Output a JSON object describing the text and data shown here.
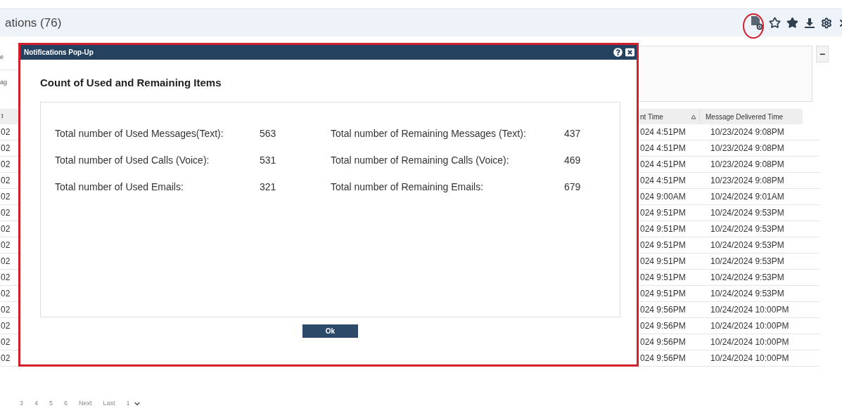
{
  "header": {
    "title": "ations (76)"
  },
  "left_strip": {
    "labels": [
      "e",
      "ag"
    ],
    "header": "t",
    "cells": [
      "02",
      "02",
      "02",
      "02",
      "02",
      "02",
      "02",
      "02",
      "02",
      "02",
      "02",
      "02",
      "02",
      "02",
      "02"
    ]
  },
  "collapse_button": "−",
  "table": {
    "columns": [
      "nt Time",
      "Message Delivered Time"
    ],
    "rows": [
      [
        "024 4:51PM",
        "10/23/2024 9:08PM"
      ],
      [
        "024 4:51PM",
        "10/23/2024 9:08PM"
      ],
      [
        "024 4:51PM",
        "10/23/2024 9:08PM"
      ],
      [
        "024 4:51PM",
        "10/23/2024 9:08PM"
      ],
      [
        "024 9:00AM",
        "10/24/2024 9:01AM"
      ],
      [
        "024 9:51PM",
        "10/24/2024 9:53PM"
      ],
      [
        "024 9:51PM",
        "10/24/2024 9:53PM"
      ],
      [
        "024 9:51PM",
        "10/24/2024 9:53PM"
      ],
      [
        "024 9:51PM",
        "10/24/2024 9:53PM"
      ],
      [
        "024 9:51PM",
        "10/24/2024 9:53PM"
      ],
      [
        "024 9:51PM",
        "10/24/2024 9:53PM"
      ],
      [
        "024 9:56PM",
        "10/24/2024 10:00PM"
      ],
      [
        "024 9:56PM",
        "10/24/2024 10:00PM"
      ],
      [
        "024 9:56PM",
        "10/24/2024 10:00PM"
      ],
      [
        "024 9:56PM",
        "10/24/2024 10:00PM"
      ]
    ]
  },
  "pagination": [
    "3",
    "4",
    "5",
    "6",
    "Next",
    "Last",
    "1"
  ],
  "dialog": {
    "title": "Notifications Pop-Up",
    "heading": "Count of Used and Remaining Items",
    "stats": [
      {
        "used_label": "Total number of Used Messages(Text):",
        "used_value": "563",
        "remaining_label": "Total number of Remaining Messages (Text):",
        "remaining_value": "437"
      },
      {
        "used_label": "Total number of Used Calls (Voice):",
        "used_value": "531",
        "remaining_label": "Total number of Remaining Calls (Voice):",
        "remaining_value": "469"
      },
      {
        "used_label": "Total number of Used Emails:",
        "used_value": "321",
        "remaining_label": "Total number of Remaining Emails:",
        "remaining_value": "679"
      }
    ],
    "ok_button": "Ok"
  }
}
